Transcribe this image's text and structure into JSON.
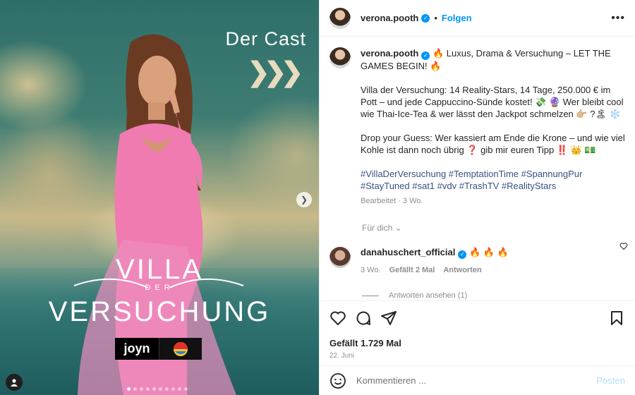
{
  "media": {
    "cast_title": "Der Cast",
    "chevrons": "❯❯❯",
    "show_title_top": "VILLA",
    "show_title_der": "DER",
    "show_title_bottom": "VERSUCHUNG",
    "logo_joyn": "joyn",
    "slide_count": 10,
    "active_slide": 1
  },
  "header": {
    "username": "verona.pooth",
    "separator": "•",
    "follow_label": "Folgen",
    "more_label": "•••"
  },
  "caption": {
    "username": "verona.pooth",
    "line1": "🔥 Luxus, Drama & Versuchung – LET THE GAMES BEGIN! 🔥",
    "paragraph2": "Villa der Versuchung: 14 Reality-Stars, 14 Tage, 250.000 € im Pott – und jede Cappuccino-Sünde kostet! 💸 🔮 Wer bleibt cool wie Thai-Ice-Tea & wer lässt den Jackpot schmelzen 👉🏼 ?🏝 ❄️",
    "paragraph3": "Drop your Guess: Wer kassiert am Ende die Krone – und wie viel Kohle ist dann noch übrig ❓ gib mir euren Tipp ‼️ 👑 💵",
    "hashtags": "#VillaDerVersuchung #TemptationTime #SpannungPur #StayTuned #sat1 #vdv #TrashTV #RealityStars",
    "meta": "Bearbeitet · 3 Wo."
  },
  "for_you_label": "Für dich ⌄",
  "comment": {
    "username": "danahuschert_official",
    "text": "🔥 🔥 🔥",
    "time": "3 Wo.",
    "likes": "Gefällt 2 Mal",
    "reply_label": "Antworten",
    "view_replies": "Antworten ansehen (1)"
  },
  "post_actions": {
    "likes_label": "Gefällt 1.729 Mal",
    "date": "22. Juni"
  },
  "comment_bar": {
    "placeholder": "Kommentieren ...",
    "post_label": "Posten"
  }
}
